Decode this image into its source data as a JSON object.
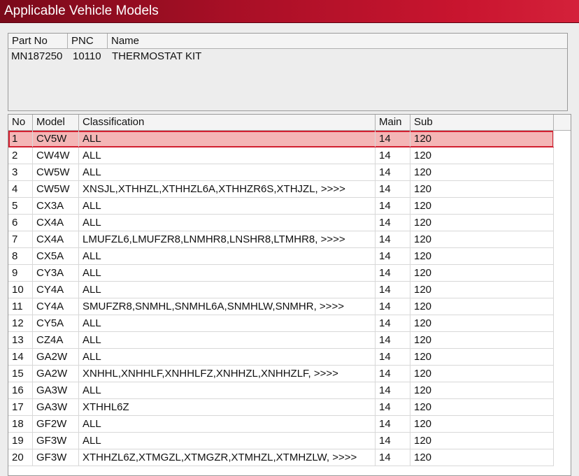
{
  "window": {
    "title": "Applicable Vehicle Models"
  },
  "part_panel": {
    "headers": {
      "part_no": "Part No",
      "pnc": "PNC",
      "name": "Name"
    },
    "row": {
      "part_no": "MN187250",
      "pnc": "10110",
      "name": "THERMOSTAT KIT"
    }
  },
  "grid": {
    "headers": {
      "no": "No",
      "model": "Model",
      "classification": "Classification",
      "main": "Main",
      "sub": "Sub"
    },
    "selected_row": 1,
    "rows": [
      {
        "no": "1",
        "model": "CV5W",
        "classification": "ALL",
        "main": "14",
        "sub": "120"
      },
      {
        "no": "2",
        "model": "CW4W",
        "classification": "ALL",
        "main": "14",
        "sub": "120"
      },
      {
        "no": "3",
        "model": "CW5W",
        "classification": "ALL",
        "main": "14",
        "sub": "120"
      },
      {
        "no": "4",
        "model": "CW5W",
        "classification": "XNSJL,XTHHZL,XTHHZL6A,XTHHZR6S,XTHJZL,  >>>>",
        "main": "14",
        "sub": "120"
      },
      {
        "no": "5",
        "model": "CX3A",
        "classification": "ALL",
        "main": "14",
        "sub": "120"
      },
      {
        "no": "6",
        "model": "CX4A",
        "classification": "ALL",
        "main": "14",
        "sub": "120"
      },
      {
        "no": "7",
        "model": "CX4A",
        "classification": "LMUFZL6,LMUFZR8,LNMHR8,LNSHR8,LTMHR8,  >>>>",
        "main": "14",
        "sub": "120"
      },
      {
        "no": "8",
        "model": "CX5A",
        "classification": "ALL",
        "main": "14",
        "sub": "120"
      },
      {
        "no": "9",
        "model": "CY3A",
        "classification": "ALL",
        "main": "14",
        "sub": "120"
      },
      {
        "no": "10",
        "model": "CY4A",
        "classification": "ALL",
        "main": "14",
        "sub": "120"
      },
      {
        "no": "11",
        "model": "CY4A",
        "classification": "SMUFZR8,SNMHL,SNMHL6A,SNMHLW,SNMHR,  >>>>",
        "main": "14",
        "sub": "120"
      },
      {
        "no": "12",
        "model": "CY5A",
        "classification": "ALL",
        "main": "14",
        "sub": "120"
      },
      {
        "no": "13",
        "model": "CZ4A",
        "classification": "ALL",
        "main": "14",
        "sub": "120"
      },
      {
        "no": "14",
        "model": "GA2W",
        "classification": "ALL",
        "main": "14",
        "sub": "120"
      },
      {
        "no": "15",
        "model": "GA2W",
        "classification": "XNHHL,XNHHLF,XNHHLFZ,XNHHZL,XNHHZLF,  >>>>",
        "main": "14",
        "sub": "120"
      },
      {
        "no": "16",
        "model": "GA3W",
        "classification": "ALL",
        "main": "14",
        "sub": "120"
      },
      {
        "no": "17",
        "model": "GA3W",
        "classification": "XTHHL6Z",
        "main": "14",
        "sub": "120"
      },
      {
        "no": "18",
        "model": "GF2W",
        "classification": "ALL",
        "main": "14",
        "sub": "120"
      },
      {
        "no": "19",
        "model": "GF3W",
        "classification": "ALL",
        "main": "14",
        "sub": "120"
      },
      {
        "no": "20",
        "model": "GF3W",
        "classification": "XTHHZL6Z,XTMGZL,XTMGZR,XTMHZL,XTMHZLW,  >>>>",
        "main": "14",
        "sub": "120"
      }
    ]
  }
}
